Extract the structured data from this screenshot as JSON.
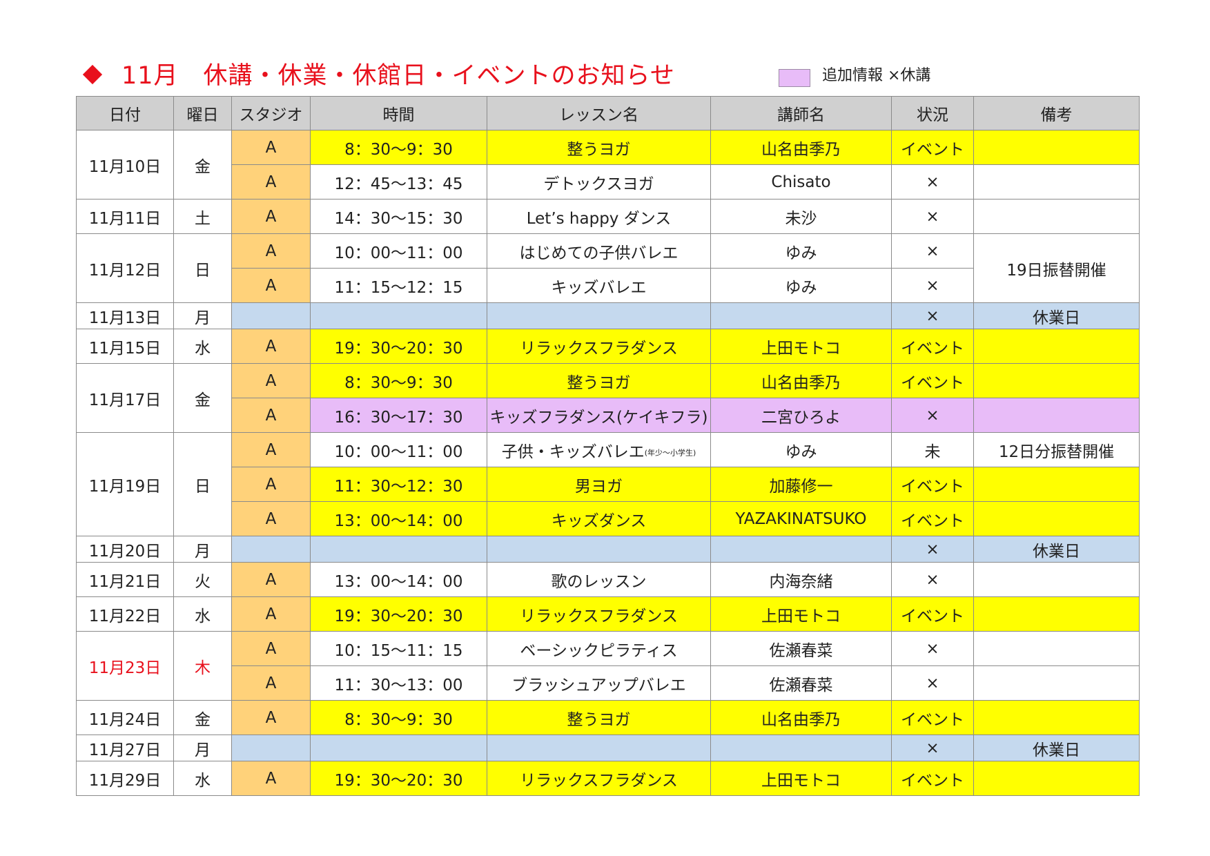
{
  "title": {
    "text": "11月　休講・休業・休館日・イベントのお知らせ",
    "legend": "追加情報 ×休講"
  },
  "headers": [
    "日付",
    "曜日",
    "スタジオ",
    "時間",
    "レッスン名",
    "講師名",
    "状況",
    "備考"
  ],
  "rows": [
    {
      "date": "11月10日",
      "dow": "金",
      "studio": "A",
      "time": "8：30～9：30",
      "lesson": "整うヨガ",
      "teacher": "山名由季乃",
      "status": "イベント",
      "notes": ""
    },
    {
      "studio": "A",
      "time": "12：45～13：45",
      "lesson": "デトックスヨガ",
      "teacher": "Chisato",
      "status": "×"
    },
    {
      "date": "11月11日",
      "dow": "土",
      "studio": "A",
      "time": "14：30～15：30",
      "lesson": "Let’s happy ダンス",
      "teacher": "未沙",
      "status": "×",
      "notes": ""
    },
    {
      "date": "11月12日",
      "dow": "日",
      "studio": "A",
      "time": "10：00～11：00",
      "lesson": "はじめての子供バレエ",
      "teacher": "ゆみ",
      "status": "×",
      "notes": "19日振替開催"
    },
    {
      "studio": "A",
      "time": "11：15～12：15",
      "lesson": "キッズバレエ",
      "teacher": "ゆみ",
      "status": "×"
    },
    {
      "date": "11月13日",
      "dow": "月",
      "studio": "",
      "time": "",
      "lesson": "",
      "teacher": "",
      "status": "×",
      "notes": "休業日"
    },
    {
      "date": "11月15日",
      "dow": "水",
      "studio": "A",
      "time": "19：30～20：30",
      "lesson": "リラックスフラダンス",
      "teacher": "上田モトコ",
      "status": "イベント",
      "notes": ""
    },
    {
      "date": "11月17日",
      "dow": "金",
      "studio": "A",
      "time": "8：30～9：30",
      "lesson": "整うヨガ",
      "teacher": "山名由季乃",
      "status": "イベント",
      "notes": ""
    },
    {
      "studio": "A",
      "time": "16：30～17：30",
      "lesson": "キッズフラダンス(ケイキフラ)",
      "teacher": "二宮ひろよ",
      "status": "×",
      "notes": ""
    },
    {
      "date": "11月19日",
      "dow": "日",
      "studio": "A",
      "time": "10：00～11：00",
      "lesson": "子供・キッズバレエ",
      "lesson_note": "(年少～小学生)",
      "teacher": "ゆみ",
      "status": "未",
      "notes": "12日分振替開催"
    },
    {
      "studio": "A",
      "time": "11：30～12：30",
      "lesson": "男ヨガ",
      "teacher": "加藤修一",
      "status": "イベント",
      "notes": ""
    },
    {
      "studio": "A",
      "time": "13：00～14：00",
      "lesson": "キッズダンス",
      "teacher": "YAZAKINATSUKO",
      "status": "イベント",
      "notes": ""
    },
    {
      "date": "11月20日",
      "dow": "月",
      "studio": "",
      "time": "",
      "lesson": "",
      "teacher": "",
      "status": "×",
      "notes": "休業日"
    },
    {
      "date": "11月21日",
      "dow": "火",
      "studio": "A",
      "time": "13：00～14：00",
      "lesson": "歌のレッスン",
      "teacher": "内海奈緒",
      "status": "×",
      "notes": ""
    },
    {
      "date": "11月22日",
      "dow": "水",
      "studio": "A",
      "time": "19：30～20：30",
      "lesson": "リラックスフラダンス",
      "teacher": "上田モトコ",
      "status": "イベント",
      "notes": ""
    },
    {
      "date": "11月23日",
      "dow": "木",
      "studio": "A",
      "time": "10：15～11：15",
      "lesson": "ベーシックピラティス",
      "teacher": "佐瀬春菜",
      "status": "×",
      "notes": ""
    },
    {
      "studio": "A",
      "time": "11：30～13：00",
      "lesson": "ブラッシュアップバレエ",
      "teacher": "佐瀬春菜",
      "status": "×",
      "notes": ""
    },
    {
      "date": "11月24日",
      "dow": "金",
      "studio": "A",
      "time": "8：30～9：30",
      "lesson": "整うヨガ",
      "teacher": "山名由季乃",
      "status": "イベント",
      "notes": ""
    },
    {
      "date": "11月27日",
      "dow": "月",
      "studio": "",
      "time": "",
      "lesson": "",
      "teacher": "",
      "status": "×",
      "notes": "休業日"
    },
    {
      "date": "11月29日",
      "dow": "水",
      "studio": "A",
      "time": "19：30～20：30",
      "lesson": "リラックスフラダンス",
      "teacher": "上田モトコ",
      "status": "イベント",
      "notes": ""
    }
  ],
  "colors": {
    "title_red": "#e8101c",
    "event_yellow": "#ffff00",
    "added_purple": "#e8bcf8",
    "closed_blue": "#c5d9ee",
    "studio_orange": "#ffd27a",
    "header_gray": "#d0d0d0"
  }
}
